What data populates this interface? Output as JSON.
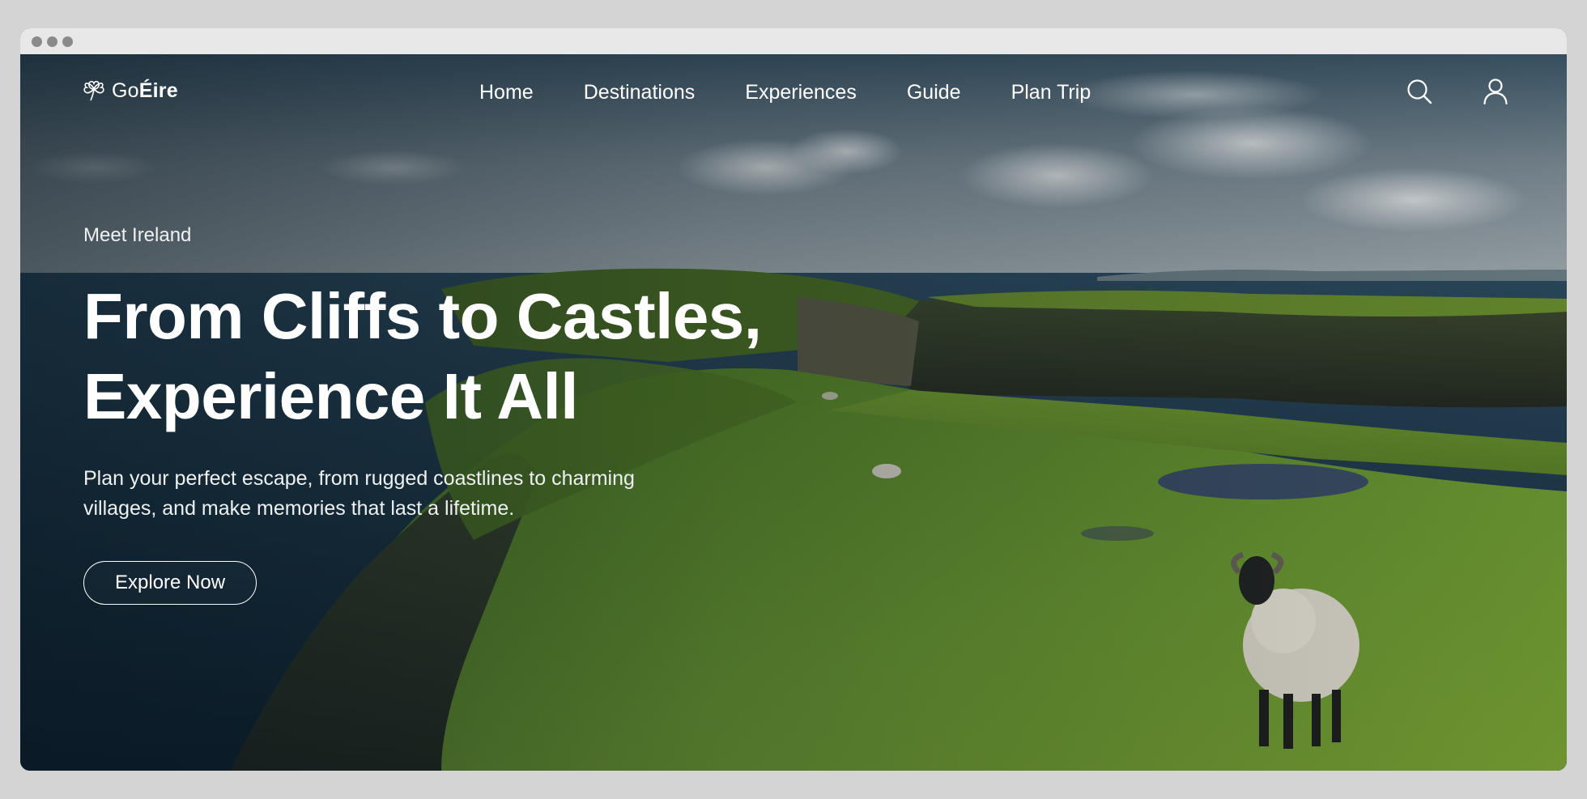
{
  "window": {
    "controls": [
      "close",
      "minimize",
      "maximize"
    ]
  },
  "brand": {
    "prefix": "Go",
    "suffix": "Éire",
    "icon": "shamrock-icon"
  },
  "nav": {
    "items": [
      {
        "label": "Home"
      },
      {
        "label": "Destinations"
      },
      {
        "label": "Experiences"
      },
      {
        "label": "Guide"
      },
      {
        "label": "Plan Trip"
      }
    ],
    "icons": [
      "search-icon",
      "user-icon"
    ]
  },
  "hero": {
    "eyebrow": "Meet Ireland",
    "title_line1": "From Cliffs to Castles,",
    "title_line2": "Experience It All",
    "description": "Plan your perfect escape, from rugged coastlines to charming villages, and make memories that last a lifetime.",
    "cta": "Explore Now"
  },
  "colors": {
    "sky": "#5d6f7d",
    "sea": "#1f3d52",
    "grass": "#5e8a2a",
    "cliff": "#3b3f32",
    "text": "#ffffff",
    "frame": "#d4d4d4"
  }
}
